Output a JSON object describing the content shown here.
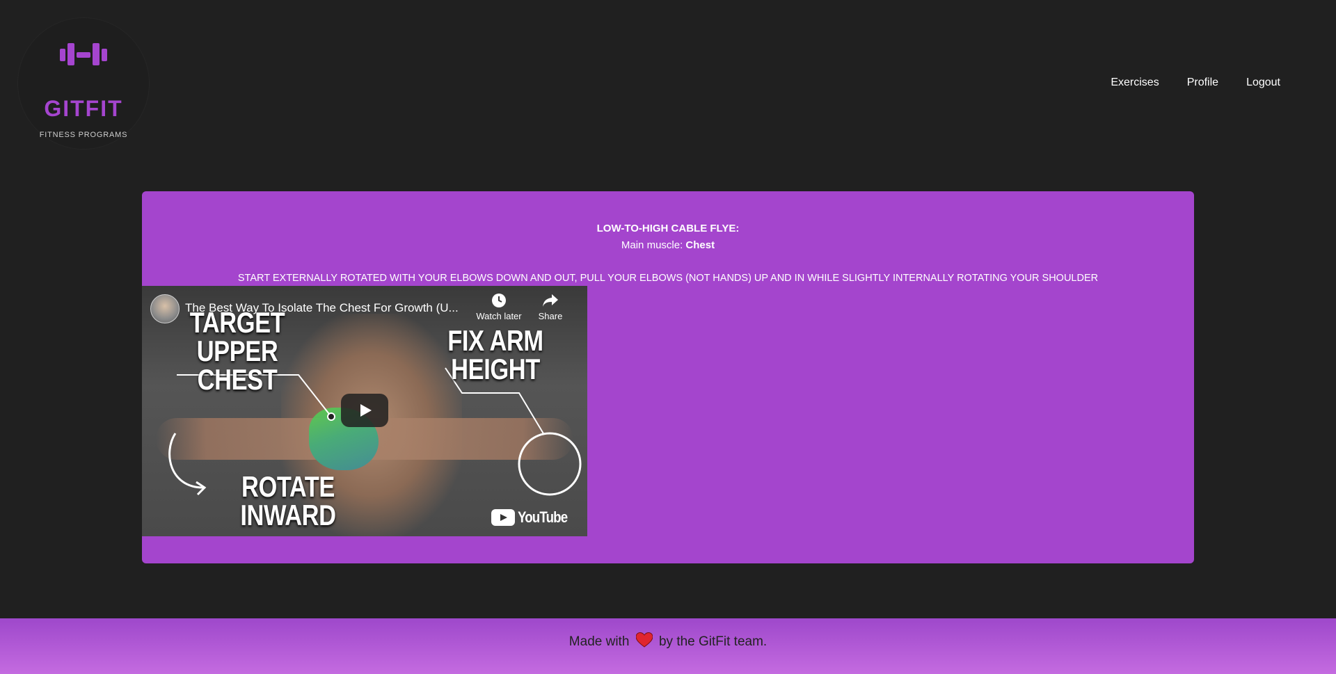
{
  "logo": {
    "brand": "GITFIT",
    "subtitle": "FITNESS PROGRAMS",
    "icon": "dumbbell-icon",
    "color": "#a545cf"
  },
  "nav": {
    "items": [
      {
        "label": "Exercises"
      },
      {
        "label": "Profile"
      },
      {
        "label": "Logout"
      }
    ]
  },
  "exercise": {
    "title": "LOW-TO-HIGH CABLE FLYE:",
    "muscle_prefix": "Main muscle:",
    "muscle": "Chest",
    "description": "START EXTERNALLY ROTATED WITH YOUR ELBOWS DOWN AND OUT, PULL YOUR ELBOWS (NOT HANDS) UP AND IN WHILE SLIGHTLY INTERNALLY ROTATING YOUR SHOULDER",
    "card_color": "#a445cd"
  },
  "video": {
    "title": "The Best Way To Isolate The Chest For Growth (U...",
    "watch_later": "Watch later",
    "share": "Share",
    "overlay_target_1": "TARGET",
    "overlay_target_2": "UPPER CHEST",
    "overlay_fix_1": "FIX ARM",
    "overlay_fix_2": "HEIGHT",
    "overlay_rotate_1": "ROTATE",
    "overlay_rotate_2": "INWARD",
    "brand": "YouTube"
  },
  "footer": {
    "before": "Made with",
    "after": "by the GitFit team.",
    "icon": "heart-icon"
  },
  "colors": {
    "background": "#202020",
    "accent": "#a445cd",
    "footer_gradient_top": "#9e48cb",
    "footer_gradient_bottom": "#c46be0"
  }
}
